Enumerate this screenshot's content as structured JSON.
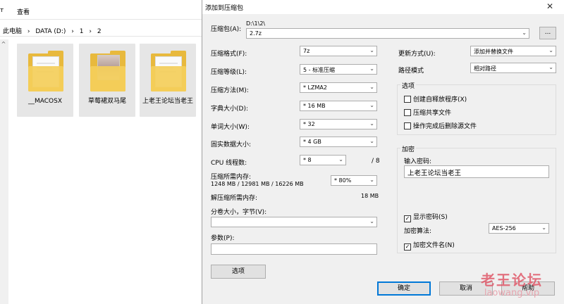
{
  "explorer": {
    "ribbon": {
      "item_1": "т",
      "item_2": "查看"
    },
    "breadcrumb": [
      "此电脑",
      "›",
      "DATA (D:)",
      "›",
      "1",
      "›",
      "2"
    ],
    "files": [
      {
        "name": "__MACOSX"
      },
      {
        "name": "草莓裙双马尾"
      },
      {
        "name": "上老王论坛当老王"
      }
    ]
  },
  "dialog": {
    "title": "添加到压缩包",
    "close": "✕",
    "archive": {
      "label": "压缩包(A):",
      "path": "D:\\1\\2\\",
      "name": "2.7z",
      "browse": "..."
    },
    "left_fields": [
      {
        "label": "压缩格式(F):",
        "value": "7z"
      },
      {
        "label": "压缩等级(L):",
        "value": "5 - 标准压缩"
      },
      {
        "label": "压缩方法(M):",
        "value": "* LZMA2"
      },
      {
        "label": "字典大小(D):",
        "value": "* 16 MB"
      },
      {
        "label": "单词大小(W):",
        "value": "* 32"
      },
      {
        "label": "固实数据大小:",
        "value": "* 4 GB"
      }
    ],
    "cpu": {
      "label": "CPU 线程数:",
      "value": "* 8",
      "max": "/ 8"
    },
    "memory": {
      "label": "压缩所需内存:",
      "detail": "1248 MB / 12981 MB / 16226 MB",
      "value": "* 80%"
    },
    "decompress": {
      "label": "解压缩所需内存:",
      "value": "18 MB"
    },
    "split": {
      "label": "分卷大小，字节(V):",
      "value": ""
    },
    "params": {
      "label": "参数(P):",
      "value": ""
    },
    "options_button": "选项",
    "update": {
      "label": "更新方式(U):",
      "value": "添加并替换文件"
    },
    "path_mode": {
      "label": "路径模式",
      "value": "相对路径"
    },
    "options_group": {
      "caption": "选项",
      "items": [
        {
          "label": "创建自释放程序(X)",
          "checked": false
        },
        {
          "label": "压缩共享文件",
          "checked": false
        },
        {
          "label": "操作完成后删除源文件",
          "checked": false
        }
      ]
    },
    "encryption": {
      "caption": "加密",
      "password_label": "输入密码:",
      "password": "上老王论坛当老王",
      "show_password": {
        "label": "显示密码(S)",
        "checked": true
      },
      "method_label": "加密算法:",
      "method": "AES-256",
      "encrypt_names": {
        "label": "加密文件名(N)",
        "checked": true
      }
    },
    "buttons": {
      "ok": "确定",
      "cancel": "取消",
      "help": "帮助"
    },
    "check_mark": "✓",
    "arrow": "⌄"
  },
  "watermark": {
    "line1": "老王论坛",
    "line2": "laowang.vip"
  }
}
